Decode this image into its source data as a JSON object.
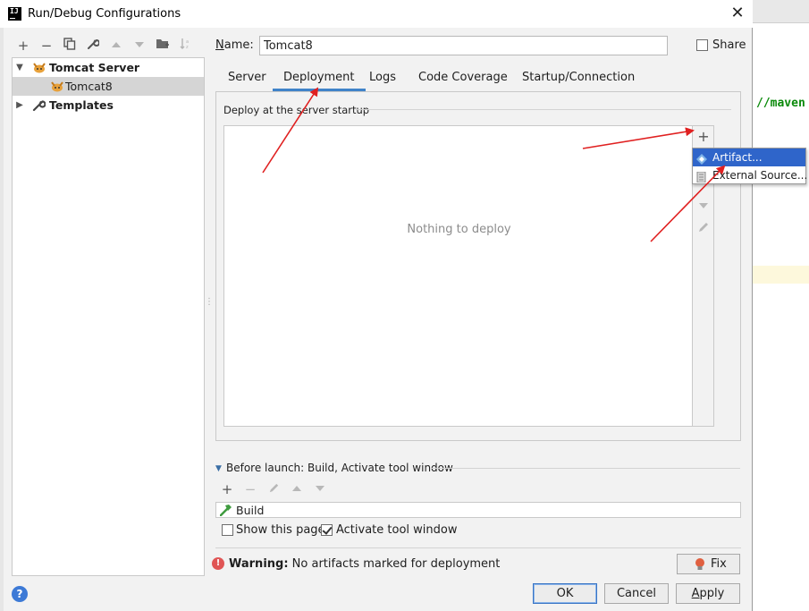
{
  "window": {
    "title": "Run/Debug Configurations",
    "app_icon_text": "IJ"
  },
  "left_toolbar": {
    "add": "+",
    "remove": "−"
  },
  "tree": {
    "items": [
      {
        "label": "Tomcat Server",
        "level": 0,
        "expanded": true
      },
      {
        "label": "Tomcat8",
        "level": 1,
        "selected": true
      },
      {
        "label": "Templates",
        "level": 0,
        "expanded": false
      }
    ]
  },
  "name_field": {
    "label": "Name:",
    "value": "Tomcat8"
  },
  "share": {
    "label": "Share",
    "checked": false
  },
  "tabs": [
    {
      "label": "Server",
      "active": false
    },
    {
      "label": "Deployment",
      "active": true
    },
    {
      "label": "Logs",
      "active": false
    },
    {
      "label": "Code Coverage",
      "active": false
    },
    {
      "label": "Startup/Connection",
      "active": false
    }
  ],
  "deployment": {
    "section_title": "Deploy at the server startup",
    "empty_text": "Nothing to deploy",
    "add_symbol": "+",
    "popup_items": [
      {
        "label": "Artifact...",
        "icon": "artifact-icon",
        "hover": true
      },
      {
        "label": "External Source...",
        "icon": "external-source-icon",
        "hover": false
      }
    ]
  },
  "before_launch": {
    "title": "Before launch: Build, Activate tool window",
    "add_symbol": "+",
    "remove_symbol": "−",
    "items": [
      {
        "label": "Build",
        "icon": "hammer-icon"
      }
    ]
  },
  "options": {
    "show_this_page": {
      "label": "Show this page",
      "checked": false
    },
    "activate_tool_window": {
      "label": "Activate tool window",
      "checked": true
    }
  },
  "warning": {
    "label": "Warning:",
    "message": "No artifacts marked for deployment",
    "fix_label": "Fix"
  },
  "buttons": {
    "ok": "OK",
    "cancel": "Cancel",
    "apply": "Apply",
    "help": "?"
  },
  "background_editor": {
    "code_fragment": "//maven"
  },
  "colors": {
    "accent": "#4083c9",
    "selection": "#2f65ca",
    "annotation": "#e02020",
    "warning": "#e05555"
  }
}
